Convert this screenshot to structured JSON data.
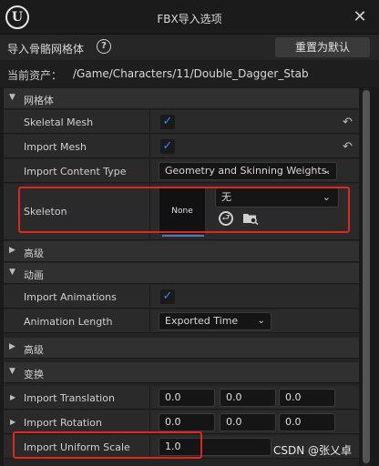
{
  "window": {
    "title": "FBX导入选项",
    "logo": "unreal-logo",
    "logo_text": "U"
  },
  "header": {
    "title": "导入骨骼网格体",
    "reset_label": "重置为默认"
  },
  "asset": {
    "label": "当前资产：",
    "path": "/Game/Characters/11/Double_Dagger_Stab"
  },
  "sections": {
    "mesh": {
      "label": "网格体"
    },
    "advanced1": {
      "label": "高级"
    },
    "animation": {
      "label": "动画"
    },
    "advanced2": {
      "label": "高级"
    },
    "transform": {
      "label": "变换"
    }
  },
  "props": {
    "skeletal_mesh": {
      "label": "Skeletal Mesh",
      "checked": true
    },
    "import_mesh": {
      "label": "Import Mesh",
      "checked": true
    },
    "import_content_type": {
      "label": "Import Content Type",
      "value": "Geometry and Skinning Weights."
    },
    "skeleton": {
      "label": "Skeleton",
      "thumb": "None",
      "value": "无"
    },
    "import_animations": {
      "label": "Import Animations",
      "checked": true
    },
    "animation_length": {
      "label": "Animation Length",
      "value": "Exported Time"
    },
    "import_translation": {
      "label": "Import Translation",
      "x": "0.0",
      "y": "0.0",
      "z": "0.0"
    },
    "import_rotation": {
      "label": "Import Rotation",
      "x": "0.0",
      "y": "0.0",
      "z": "0.0"
    },
    "import_uniform_scale": {
      "label": "Import Uniform Scale",
      "value": "1.0"
    }
  },
  "glyphs": {
    "check": "✓",
    "revert": "↶",
    "chev_open": "▼",
    "chev_closed": "▶",
    "close": "✕",
    "help": "?",
    "dropdown": "⌄",
    "use": "⮐"
  },
  "watermark": "CSDN @张乂卓",
  "colors": {
    "accent": "#2a8bf5",
    "highlight": "#e0261f",
    "background": "#242424"
  }
}
